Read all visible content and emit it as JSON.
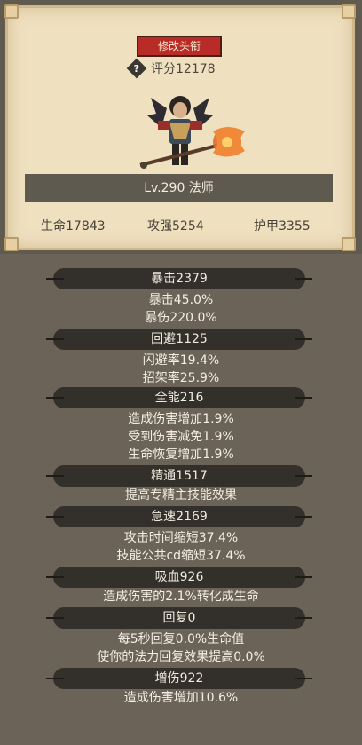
{
  "profile": {
    "edit_title_button": "修改头衔",
    "score_label": "评分12178",
    "level_class": "Lv.290 法师",
    "stats": {
      "hp": "生命17843",
      "attack": "攻强5254",
      "armor": "护甲3355"
    }
  },
  "attributes": [
    {
      "name": "暴击2379",
      "details": [
        "暴击45.0%",
        "暴伤220.0%"
      ]
    },
    {
      "name": "回避1125",
      "details": [
        "闪避率19.4%",
        "招架率25.9%"
      ]
    },
    {
      "name": "全能216",
      "details": [
        "造成伤害增加1.9%",
        "受到伤害减免1.9%",
        "生命恢复增加1.9%"
      ]
    },
    {
      "name": "精通1517",
      "details": [
        "提高专精主技能效果"
      ]
    },
    {
      "name": "急速2169",
      "details": [
        "攻击时间缩短37.4%",
        "技能公共cd缩短37.4%"
      ]
    },
    {
      "name": "吸血926",
      "details": [
        "造成伤害的2.1%转化成生命"
      ]
    },
    {
      "name": "回复0",
      "details": [
        "每5秒回复0.0%生命值",
        "使你的法力回复效果提高0.0%"
      ]
    },
    {
      "name": "增伤922",
      "details": [
        "造成伤害增加10.6%"
      ]
    }
  ]
}
